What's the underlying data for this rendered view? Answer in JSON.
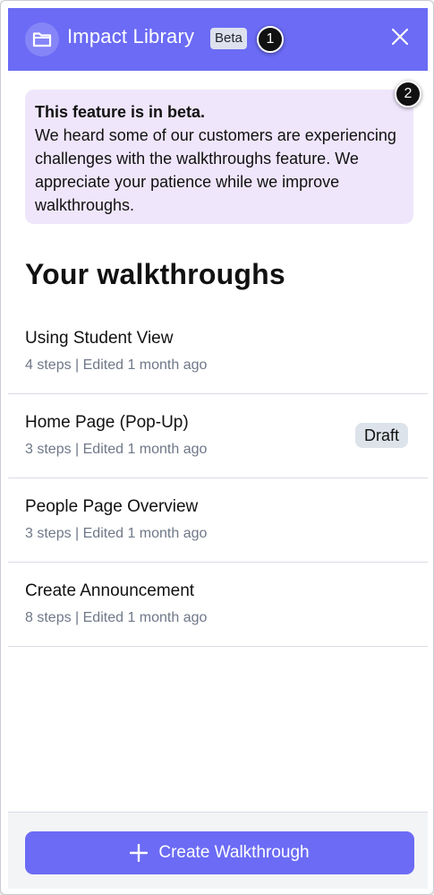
{
  "header": {
    "title": "Impact Library",
    "badge": "Beta",
    "icon": "folder-icon",
    "close_icon": "close-icon",
    "background": "#6b6bf5"
  },
  "markers": [
    "1",
    "2"
  ],
  "notice": {
    "title": "This feature is in beta.",
    "body": "We heard some of our customers are experiencing challenges with the walkthroughs feature. We appreciate your patience while we improve walkthroughs.",
    "background": "#efe6fb"
  },
  "section_title": "Your walkthroughs",
  "walkthroughs": [
    {
      "title": "Using Student View",
      "meta": "4 steps | Edited 1 month ago",
      "badge": ""
    },
    {
      "title": "Home Page (Pop-Up)",
      "meta": "3 steps | Edited 1 month ago",
      "badge": "Draft"
    },
    {
      "title": "People Page Overview",
      "meta": "3 steps | Edited 1 month ago",
      "badge": ""
    },
    {
      "title": "Create Announcement",
      "meta": "8 steps | Edited 1 month ago",
      "badge": ""
    }
  ],
  "footer": {
    "create_label": "Create Walkthrough",
    "create_icon": "plus-icon",
    "accent": "#6b6bf5"
  }
}
